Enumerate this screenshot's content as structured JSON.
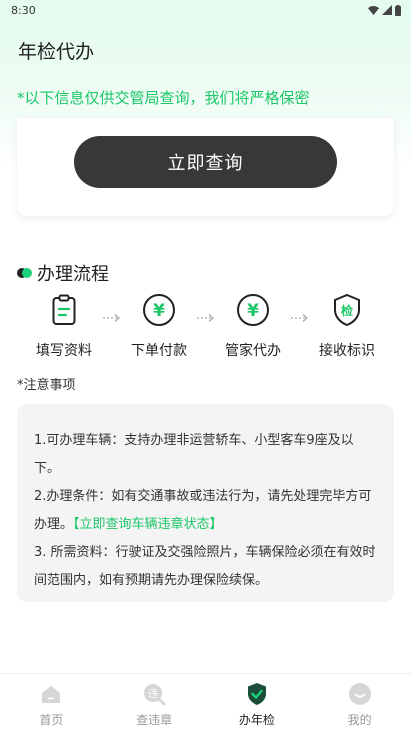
{
  "status_bar": {
    "time": "8:30"
  },
  "header": {
    "title": "年检代办"
  },
  "notice": "*以下信息仅供交管局查询，我们将严格保密",
  "query_button": "立即查询",
  "process": {
    "title": "办理流程",
    "steps": [
      {
        "label": "填写资料",
        "icon": "clipboard-icon"
      },
      {
        "label": "下单付款",
        "icon": "yuan-icon"
      },
      {
        "label": "管家代办",
        "icon": "yuan-icon"
      },
      {
        "label": "接收标识",
        "icon": "shield-inspection-icon"
      }
    ],
    "shield_char": "检",
    "yuan_char": "¥"
  },
  "notes": {
    "title": "*注意事项",
    "item1": "1.可办理车辆：支持办理非运营轿车、小型客车9座及以下。",
    "item2_text": "2.办理条件：如有交通事故或违法行为，请先处理完毕方可办理。",
    "item2_link": "【立即查询车辆违章状态】",
    "item3": "3. 所需资料：行驶证及交强险照片，车辆保险必须在有效时间范围内，如有预期请先办理保险续保。"
  },
  "bottom_nav": [
    {
      "label": "首页",
      "icon": "home-icon"
    },
    {
      "label": "查违章",
      "icon": "violation-search-icon",
      "icon_char": "违"
    },
    {
      "label": "办年检",
      "icon": "shield-check-icon",
      "active": true
    },
    {
      "label": "我的",
      "icon": "profile-icon"
    }
  ],
  "colors": {
    "accent": "#1bc768",
    "button": "#383838",
    "active_tab": "#1b4d3a"
  }
}
